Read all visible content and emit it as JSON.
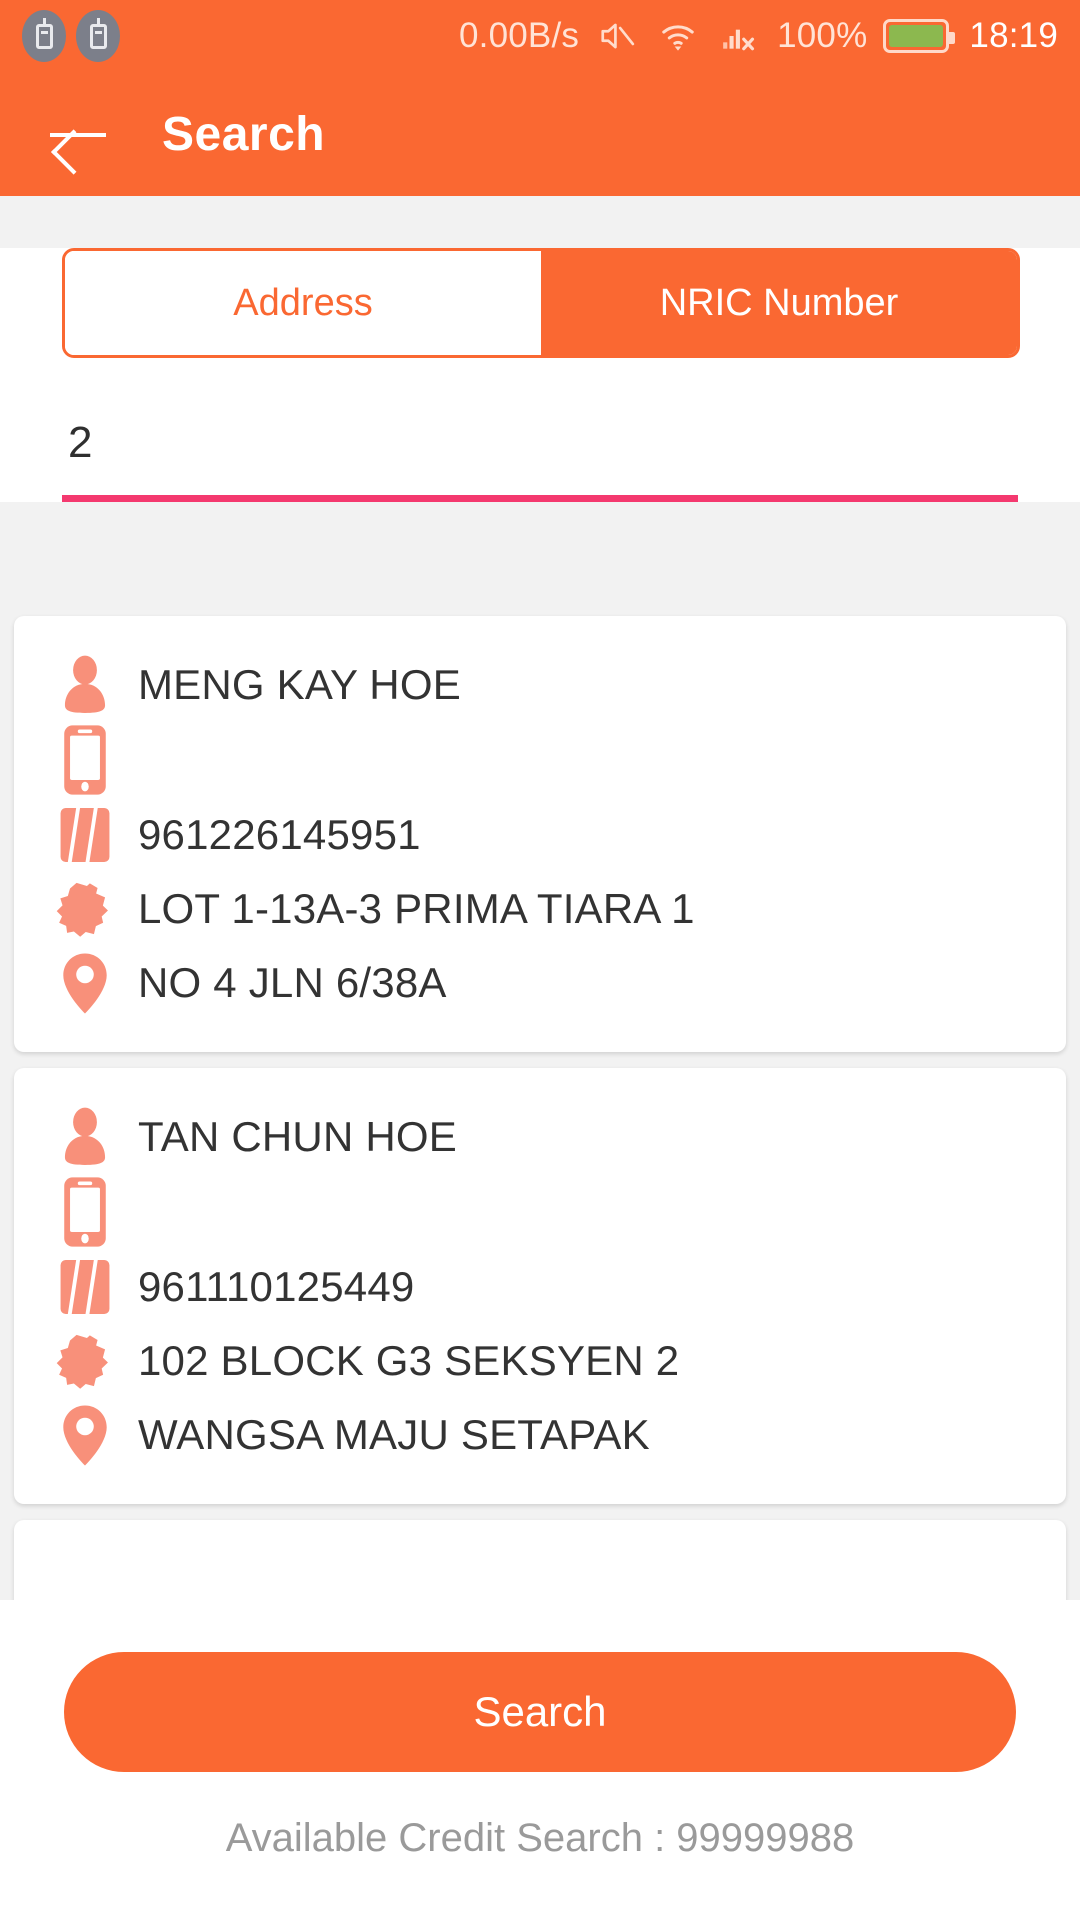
{
  "statusbar": {
    "usb_icon_1": "usb-icon",
    "usb_icon_2": "usb-icon",
    "network_speed": "0.00B/s",
    "mute_icon": "volume-mute-icon",
    "wifi_icon": "wifi-icon",
    "signal_icon": "cellular-no-service-icon",
    "battery_percent": "100%",
    "battery_icon": "battery-full-icon",
    "time": "18:19"
  },
  "appbar": {
    "back_icon": "back-arrow-icon",
    "title": "Search"
  },
  "tabs": [
    {
      "label": "Address",
      "selected": false
    },
    {
      "label": "NRIC Number",
      "selected": true
    }
  ],
  "search_field": {
    "value": "2",
    "placeholder": ""
  },
  "results": [
    {
      "name_icon": "person-icon",
      "name": "MENG KAY HOE",
      "phone_icon": "mobile-phone-icon",
      "phone": "",
      "nric_icon": "id-card-icon",
      "nric": "961226145951",
      "area_icon": "map-region-icon",
      "address_line1": "LOT 1-13A-3 PRIMA TIARA 1",
      "pin_icon": "location-pin-icon",
      "address_line2": "NO 4 JLN 6/38A"
    },
    {
      "name_icon": "person-icon",
      "name": "TAN CHUN HOE",
      "phone_icon": "mobile-phone-icon",
      "phone": "",
      "nric_icon": "id-card-icon",
      "nric": "961110125449",
      "area_icon": "map-region-icon",
      "address_line1": "102 BLOCK G3 SEKSYEN 2",
      "pin_icon": "location-pin-icon",
      "address_line2": "WANGSA MAJU SETAPAK"
    }
  ],
  "bottom": {
    "search_button_label": "Search",
    "credit_text": "Available Credit Search : 99999988"
  },
  "colors": {
    "brand_orange": "#FA6832",
    "icon_salmon": "#F8907A",
    "input_underline_pink": "#F4396F",
    "battery_green": "#8CB84F",
    "text_dark": "#333333",
    "muted_gray": "#9A9A9A",
    "page_background": "#F2F2F2"
  }
}
